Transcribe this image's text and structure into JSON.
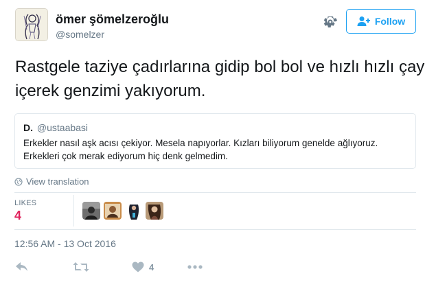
{
  "header": {
    "display_name": "ömer şömelzeroğlu",
    "handle": "@somelzer",
    "follow_label": "Follow"
  },
  "tweet": {
    "text": "Rastgele taziye çadırlarına gidip bol bol ve hızlı hızlı çay içerek genzimi yakıyorum."
  },
  "quoted_tweet": {
    "name": "D.",
    "handle": "@ustaabasi",
    "text": "Erkekler nasıl aşk acısı çekiyor. Mesela napıyorlar. Kızları biliyorum genelde ağlıyoruz. Erkekleri çok merak ediyorum hiç denk gelmedim."
  },
  "translate_label": "View translation",
  "stats": {
    "likes_label": "LIKES",
    "likes_count": "4"
  },
  "timestamp": "12:56 AM - 13 Oct 2016",
  "actions": {
    "like_count": "4"
  },
  "colors": {
    "accent": "#1da1f2",
    "like": "#e0245e",
    "muted": "#657786",
    "icon": "#aab8c2",
    "border": "#e1e8ed"
  }
}
